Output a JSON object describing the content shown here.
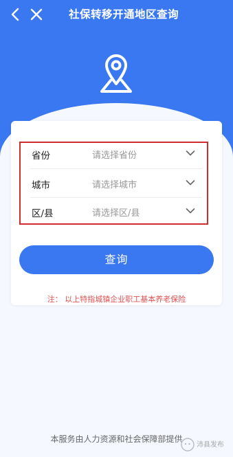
{
  "header": {
    "title": "社保转移开通地区查询",
    "back_icon": "chevron-left-icon",
    "close_icon": "close-icon"
  },
  "hero": {
    "icon": "location-pin-icon",
    "background_color": "#3a78f2"
  },
  "form": {
    "rows": [
      {
        "label": "省份",
        "placeholder": "请选择省份"
      },
      {
        "label": "城市",
        "placeholder": "请选择城市"
      },
      {
        "label": "区/县",
        "placeholder": "请选择区/县"
      }
    ],
    "highlight_color": "#d12c2c"
  },
  "query_button": {
    "label": "查询"
  },
  "note": {
    "text": "注：  以上特指城镇企业职工基本养老保险"
  },
  "footer": {
    "text": "本服务由人力资源和社会保障部提供"
  },
  "watermark": {
    "text": "沛县发布"
  }
}
